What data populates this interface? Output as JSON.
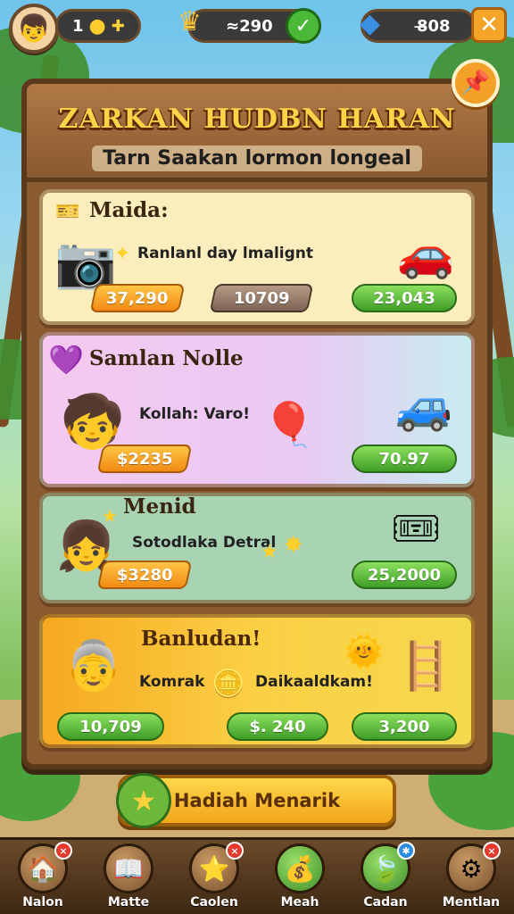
{
  "hud": {
    "level": "1",
    "currency_1": "≈290",
    "currency_2": "8̶08"
  },
  "header": {
    "title": "ZARKAN HUDBN HARAN",
    "subtitle": "Tarn Saakan lormon longeal"
  },
  "cards": [
    {
      "title": "Maida:",
      "text": "Ranlanl day lmalignt",
      "tags": [
        "37,290",
        "10709",
        "23,043"
      ],
      "bg": "#fbeebc"
    },
    {
      "title": "Samlan Nolle",
      "text": "Kollah: Varo!",
      "tags": [
        "$2235",
        "70.97"
      ],
      "bg": "#eec6ef"
    },
    {
      "title": "Menid",
      "text": "Sotodlaka Detral",
      "tags": [
        "$3280",
        "25,2000"
      ],
      "bg": "#a8d4b3"
    },
    {
      "title": "Banludan!",
      "text_left": "Komrak",
      "text_right": "Daikaaldkam!",
      "tags": [
        "10,709",
        "$. 240",
        "3,200"
      ],
      "bg": "#fbd045"
    }
  ],
  "cta": {
    "label": "Hadiah Menarik"
  },
  "nav": [
    {
      "label": "Nalon",
      "icon": "house-icon",
      "badge": "×"
    },
    {
      "label": "Matte",
      "icon": "book-icon",
      "badge": ""
    },
    {
      "label": "Caolen",
      "icon": "star-icon",
      "badge": "×"
    },
    {
      "label": "Meah",
      "icon": "coin-bag-icon",
      "badge": ""
    },
    {
      "label": "Cadan",
      "icon": "leaf-icon",
      "badge": "✱"
    },
    {
      "label": "Mentlan",
      "icon": "gear-icon",
      "badge": "×"
    }
  ],
  "colors": {
    "wood": "#8a5a30",
    "gold": "#ffd347",
    "green_tag": "#3f9d27",
    "orange_tag": "#f18a13"
  }
}
